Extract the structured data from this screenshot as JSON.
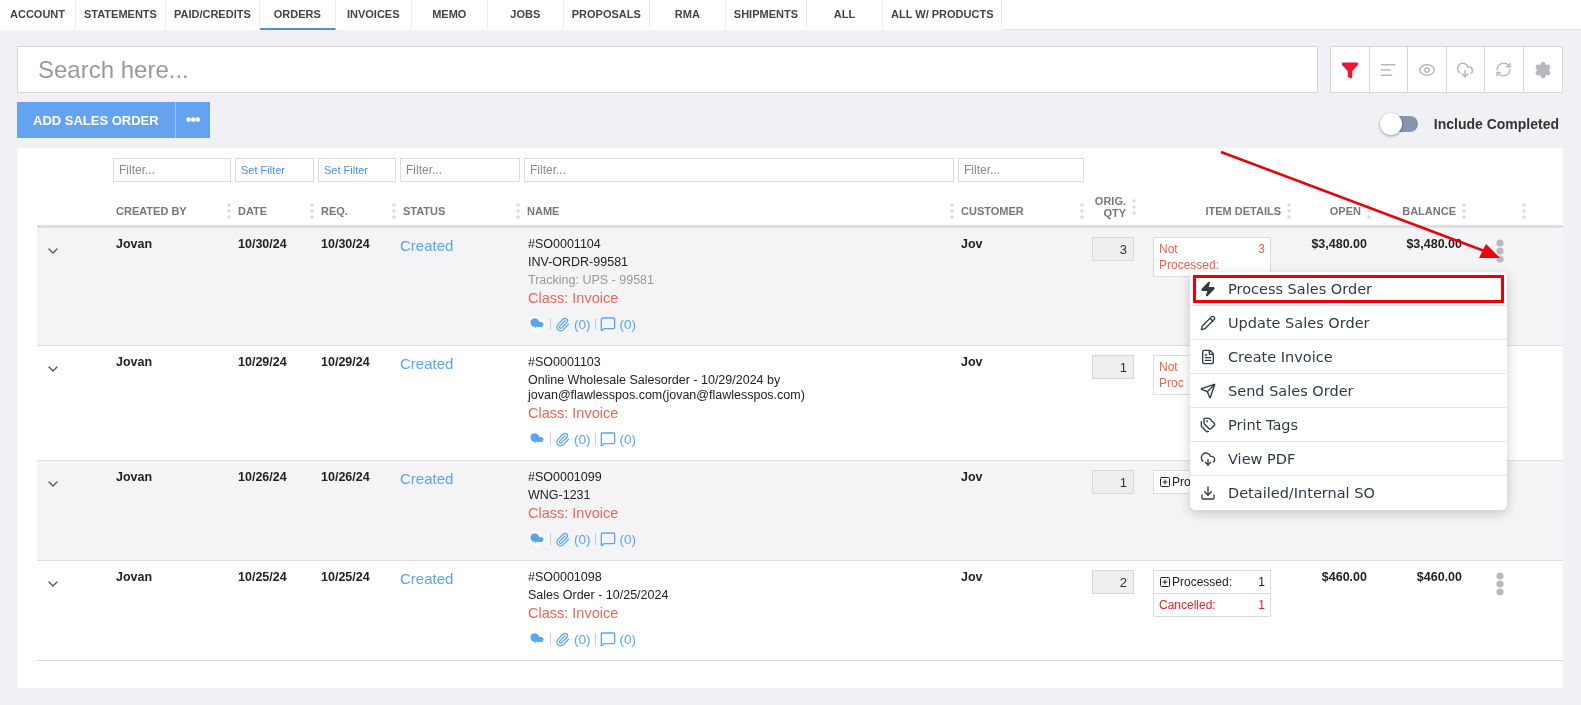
{
  "tabs": [
    {
      "label": "ACCOUNT",
      "selected": false
    },
    {
      "label": "STATEMENTS",
      "selected": false
    },
    {
      "label": "PAID/CREDITS",
      "selected": false
    },
    {
      "label": "ORDERS",
      "selected": true
    },
    {
      "label": "INVOICES",
      "selected": false
    },
    {
      "label": "MEMO",
      "selected": false
    },
    {
      "label": "JOBS",
      "selected": false
    },
    {
      "label": "PROPOSALS",
      "selected": false
    },
    {
      "label": "RMA",
      "selected": false
    },
    {
      "label": "SHIPMENTS",
      "selected": false
    },
    {
      "label": "ALL",
      "selected": false
    },
    {
      "label": "ALL W/ PRODUCTS",
      "selected": false
    }
  ],
  "search": {
    "placeholder": "Search here..."
  },
  "toolbar": [
    {
      "kind": "filter",
      "active": true
    },
    {
      "kind": "sort",
      "active": false
    },
    {
      "kind": "view",
      "active": false
    },
    {
      "kind": "export",
      "active": false
    },
    {
      "kind": "refresh",
      "active": false
    },
    {
      "kind": "settings",
      "active": false
    }
  ],
  "add_button": {
    "label": "ADD SALES ORDER",
    "more": "•••"
  },
  "include_completed": {
    "label": "Include Completed",
    "on": false
  },
  "filters": [
    {
      "kind": "text",
      "placeholder": "Filter..."
    },
    {
      "kind": "set",
      "label": "Set Filter"
    },
    {
      "kind": "set",
      "label": "Set Filter"
    },
    {
      "kind": "text",
      "placeholder": "Filter..."
    },
    {
      "kind": "text",
      "placeholder": "Filter..."
    },
    {
      "kind": "text",
      "placeholder": "Filter..."
    }
  ],
  "columns": [
    "CREATED BY",
    "DATE",
    "REQ.",
    "STATUS",
    "NAME",
    "CUSTOMER",
    "ORIG. QTY",
    "ITEM DETAILS",
    "OPEN",
    "BALANCE"
  ],
  "rows": [
    {
      "created_by": "Jovan",
      "date": "10/30/24",
      "req": "10/30/24",
      "status": "Created",
      "name_lines": [
        {
          "kind": "id",
          "text": "#SO0001104"
        },
        {
          "kind": "ref",
          "text": "INV-ORDR-99581"
        },
        {
          "kind": "tracking",
          "text": "Tracking: UPS - 99581"
        },
        {
          "kind": "class",
          "text": "Class: Invoice"
        }
      ],
      "attachments": "(0)",
      "comments": "(0)",
      "customer": "Jov",
      "qty": "3",
      "item_details": [
        {
          "kind": "not_processed",
          "expandable": false,
          "label": "Not Processed:",
          "count": "3"
        }
      ],
      "open": "$3,480.00",
      "balance": "$3,480.00",
      "menu_button": true
    },
    {
      "created_by": "Jovan",
      "date": "10/29/24",
      "req": "10/29/24",
      "status": "Created",
      "name_lines": [
        {
          "kind": "id",
          "text": "#SO0001103"
        },
        {
          "kind": "ref",
          "text": "Online Wholesale Salesorder - 10/29/2024 by jovan@flawlesspos.com(jovan@flawlesspos.com)"
        },
        {
          "kind": "class",
          "text": "Class: Invoice"
        }
      ],
      "attachments": "(0)",
      "comments": "(0)",
      "customer": "Jov",
      "qty": "1",
      "item_details": [
        {
          "kind": "not_processed",
          "expandable": false,
          "label": "Not Proc"
        }
      ],
      "menu_button": false
    },
    {
      "created_by": "Jovan",
      "date": "10/26/24",
      "req": "10/26/24",
      "status": "Created",
      "name_lines": [
        {
          "kind": "id",
          "text": "#SO0001099"
        },
        {
          "kind": "ref",
          "text": "WNG-1231"
        },
        {
          "kind": "class",
          "text": "Class: Invoice"
        }
      ],
      "attachments": "(0)",
      "comments": "(0)",
      "customer": "Jov",
      "qty": "1",
      "item_details": [
        {
          "kind": "processed",
          "expandable": true,
          "label": "Pro"
        }
      ],
      "menu_button": false
    },
    {
      "created_by": "Jovan",
      "date": "10/25/24",
      "req": "10/25/24",
      "status": "Created",
      "name_lines": [
        {
          "kind": "id",
          "text": "#SO0001098"
        },
        {
          "kind": "ref",
          "text": "Sales Order - 10/25/2024"
        },
        {
          "kind": "class",
          "text": "Class: Invoice"
        }
      ],
      "attachments": "(0)",
      "comments": "(0)",
      "customer": "Jov",
      "qty": "2",
      "item_details": [
        {
          "kind": "processed",
          "expandable": true,
          "label": "Processed:",
          "count": "1"
        },
        {
          "kind": "cancelled",
          "expandable": false,
          "label": "Cancelled:",
          "count": "1"
        }
      ],
      "open": "$460.00",
      "balance": "$460.00",
      "menu_button": true
    }
  ],
  "row_menu": [
    {
      "kind": "process",
      "label": "Process Sales Order",
      "highlighted": true
    },
    {
      "kind": "update",
      "label": "Update Sales Order",
      "highlighted": false
    },
    {
      "kind": "invoice",
      "label": "Create Invoice",
      "highlighted": false
    },
    {
      "kind": "send",
      "label": "Send Sales Order",
      "highlighted": false
    },
    {
      "kind": "tags",
      "label": "Print Tags",
      "highlighted": false
    },
    {
      "kind": "pdf",
      "label": "View PDF",
      "highlighted": false
    },
    {
      "kind": "download",
      "label": "Detailed/Internal SO",
      "highlighted": false
    }
  ],
  "annotation_arrow": true
}
